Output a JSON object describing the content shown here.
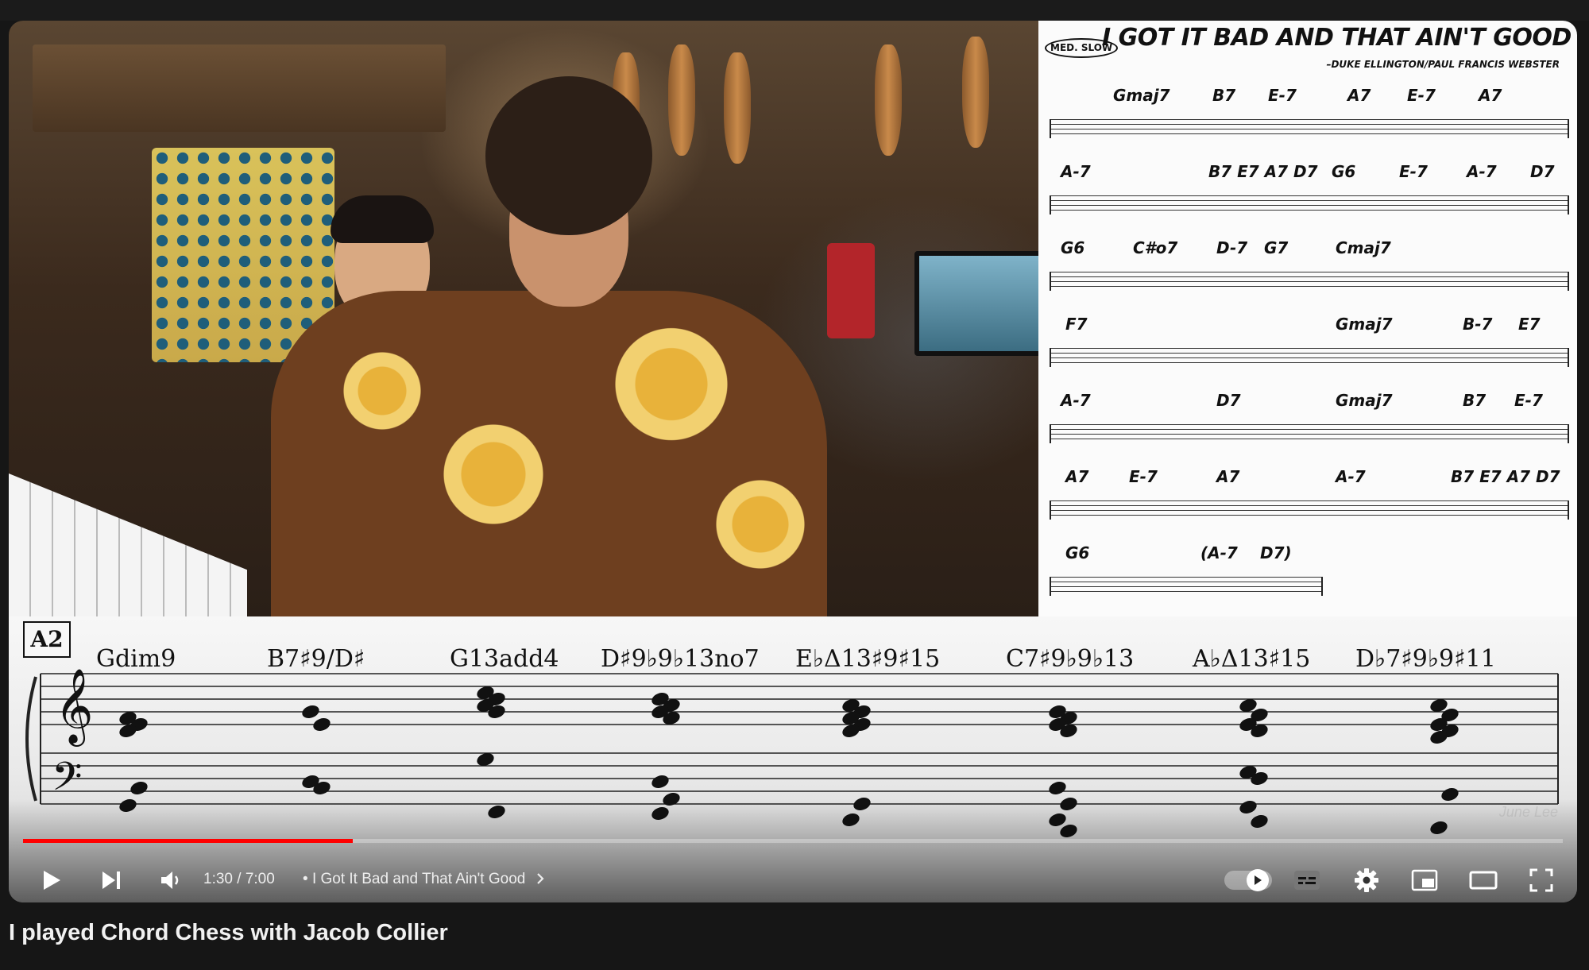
{
  "video": {
    "title": "I played Chord Chess with Jacob Collier",
    "watermark": "June Lee",
    "progress_fraction": 0.214
  },
  "lead_sheet": {
    "title": "I GOT IT BAD AND THAT AIN'T GOOD",
    "tempo": "MED. SLOW",
    "composer": "–DUKE ELLINGTON/PAUL FRANCIS WEBSTER",
    "rows": [
      [
        "Gmaj7",
        "B7",
        "E-7",
        "A7",
        "E-7",
        "A7"
      ],
      [
        "A-7",
        "B7 E7 A7 D7",
        "G6",
        "E-7",
        "A-7",
        "D7"
      ],
      [
        "G6",
        "C#o7",
        "D-7",
        "G7",
        "Cmaj7"
      ],
      [
        "F7",
        "Gmaj7",
        "B-7",
        "E7"
      ],
      [
        "A-7",
        "D7",
        "Gmaj7",
        "B7",
        "E-7"
      ],
      [
        "A7",
        "E-7",
        "A7",
        "A-7",
        "B7 E7 A7 D7"
      ],
      [
        "G6",
        "(A-7",
        "D7)"
      ]
    ]
  },
  "notation": {
    "section": "A2",
    "chords": [
      "Gdim9",
      "B7♯9/D♯",
      "G13add4",
      "D♯9♭9♭13no7",
      "E♭Δ13♯9♯15",
      "C7♯9♭9♭13",
      "A♭Δ13♯15",
      "D♭7♯9♭9♯11"
    ]
  },
  "controls": {
    "current_time": "1:30",
    "duration": "7:00",
    "time_separator": " / ",
    "chapter_bullet": "•",
    "chapter_title": "I Got It Bad and That Ain't Good"
  }
}
